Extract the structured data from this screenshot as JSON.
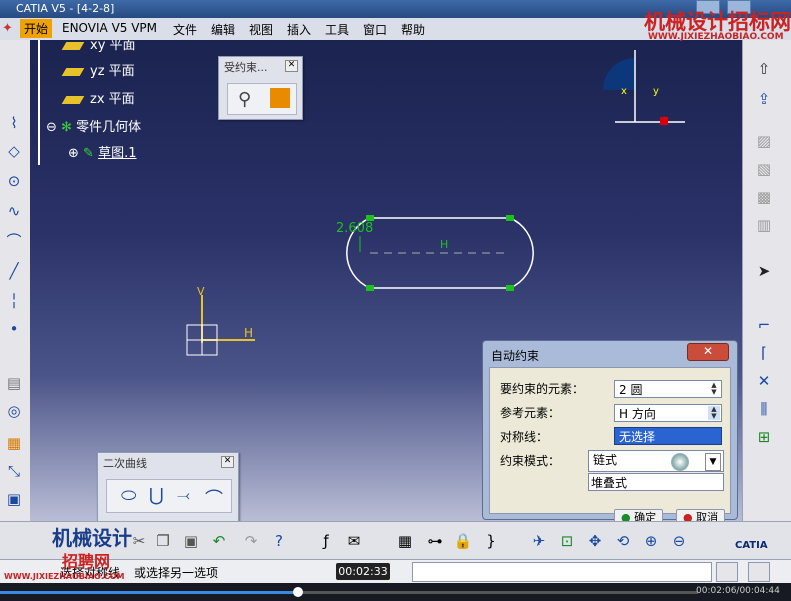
{
  "title_bar": {
    "title": "CATIA V5 - [4-2-8]"
  },
  "menu": [
    "开始",
    "ENOVIA V5 VPM",
    "文件",
    "编辑",
    "视图",
    "插入",
    "工具",
    "窗口",
    "帮助"
  ],
  "tree": {
    "items": [
      {
        "label": "xy 平面"
      },
      {
        "label": "yz 平面"
      },
      {
        "label": "zx 平面"
      },
      {
        "label": "零件几何体"
      },
      {
        "label": "草图.1"
      }
    ]
  },
  "constrained_panel": {
    "title": "受约束..."
  },
  "quadratic_panel": {
    "title": "二次曲线"
  },
  "sketch": {
    "dimension": "2.608",
    "h_label": "H",
    "v_label": "V",
    "h_marker": "H"
  },
  "compass": {
    "x": "x",
    "y": "y"
  },
  "dialog": {
    "title": "自动约束",
    "rows": [
      {
        "label": "要约束的元素：",
        "value": "2 圆"
      },
      {
        "label": "参考元素：",
        "value": "H 方向"
      },
      {
        "label": "对称线：",
        "value": "无选择"
      },
      {
        "label": "约束模式：",
        "value": "链式"
      }
    ],
    "mode_options": [
      "链式",
      "堆叠式"
    ],
    "ok": "确定",
    "cancel": "取消"
  },
  "status": {
    "text": "或选择另一选项",
    "prefix": "选择对称线",
    "tooltip_time": "00:02:33",
    "time_display": "00:02:06/00:04:44"
  },
  "watermark": {
    "cn": "机械设计",
    "cn2": "招聘网",
    "url": "WWW.JIXIEZHAOBIAO.COM",
    "cn_top": "机械设计招标网",
    "url_top": "WWW.JIXIEZHAOBIAO.COM"
  },
  "branding": "CATIA",
  "colors": {
    "accent": "#f0a300",
    "sketch_green": "#1bc21b",
    "selection_blue": "#2a64d0"
  }
}
